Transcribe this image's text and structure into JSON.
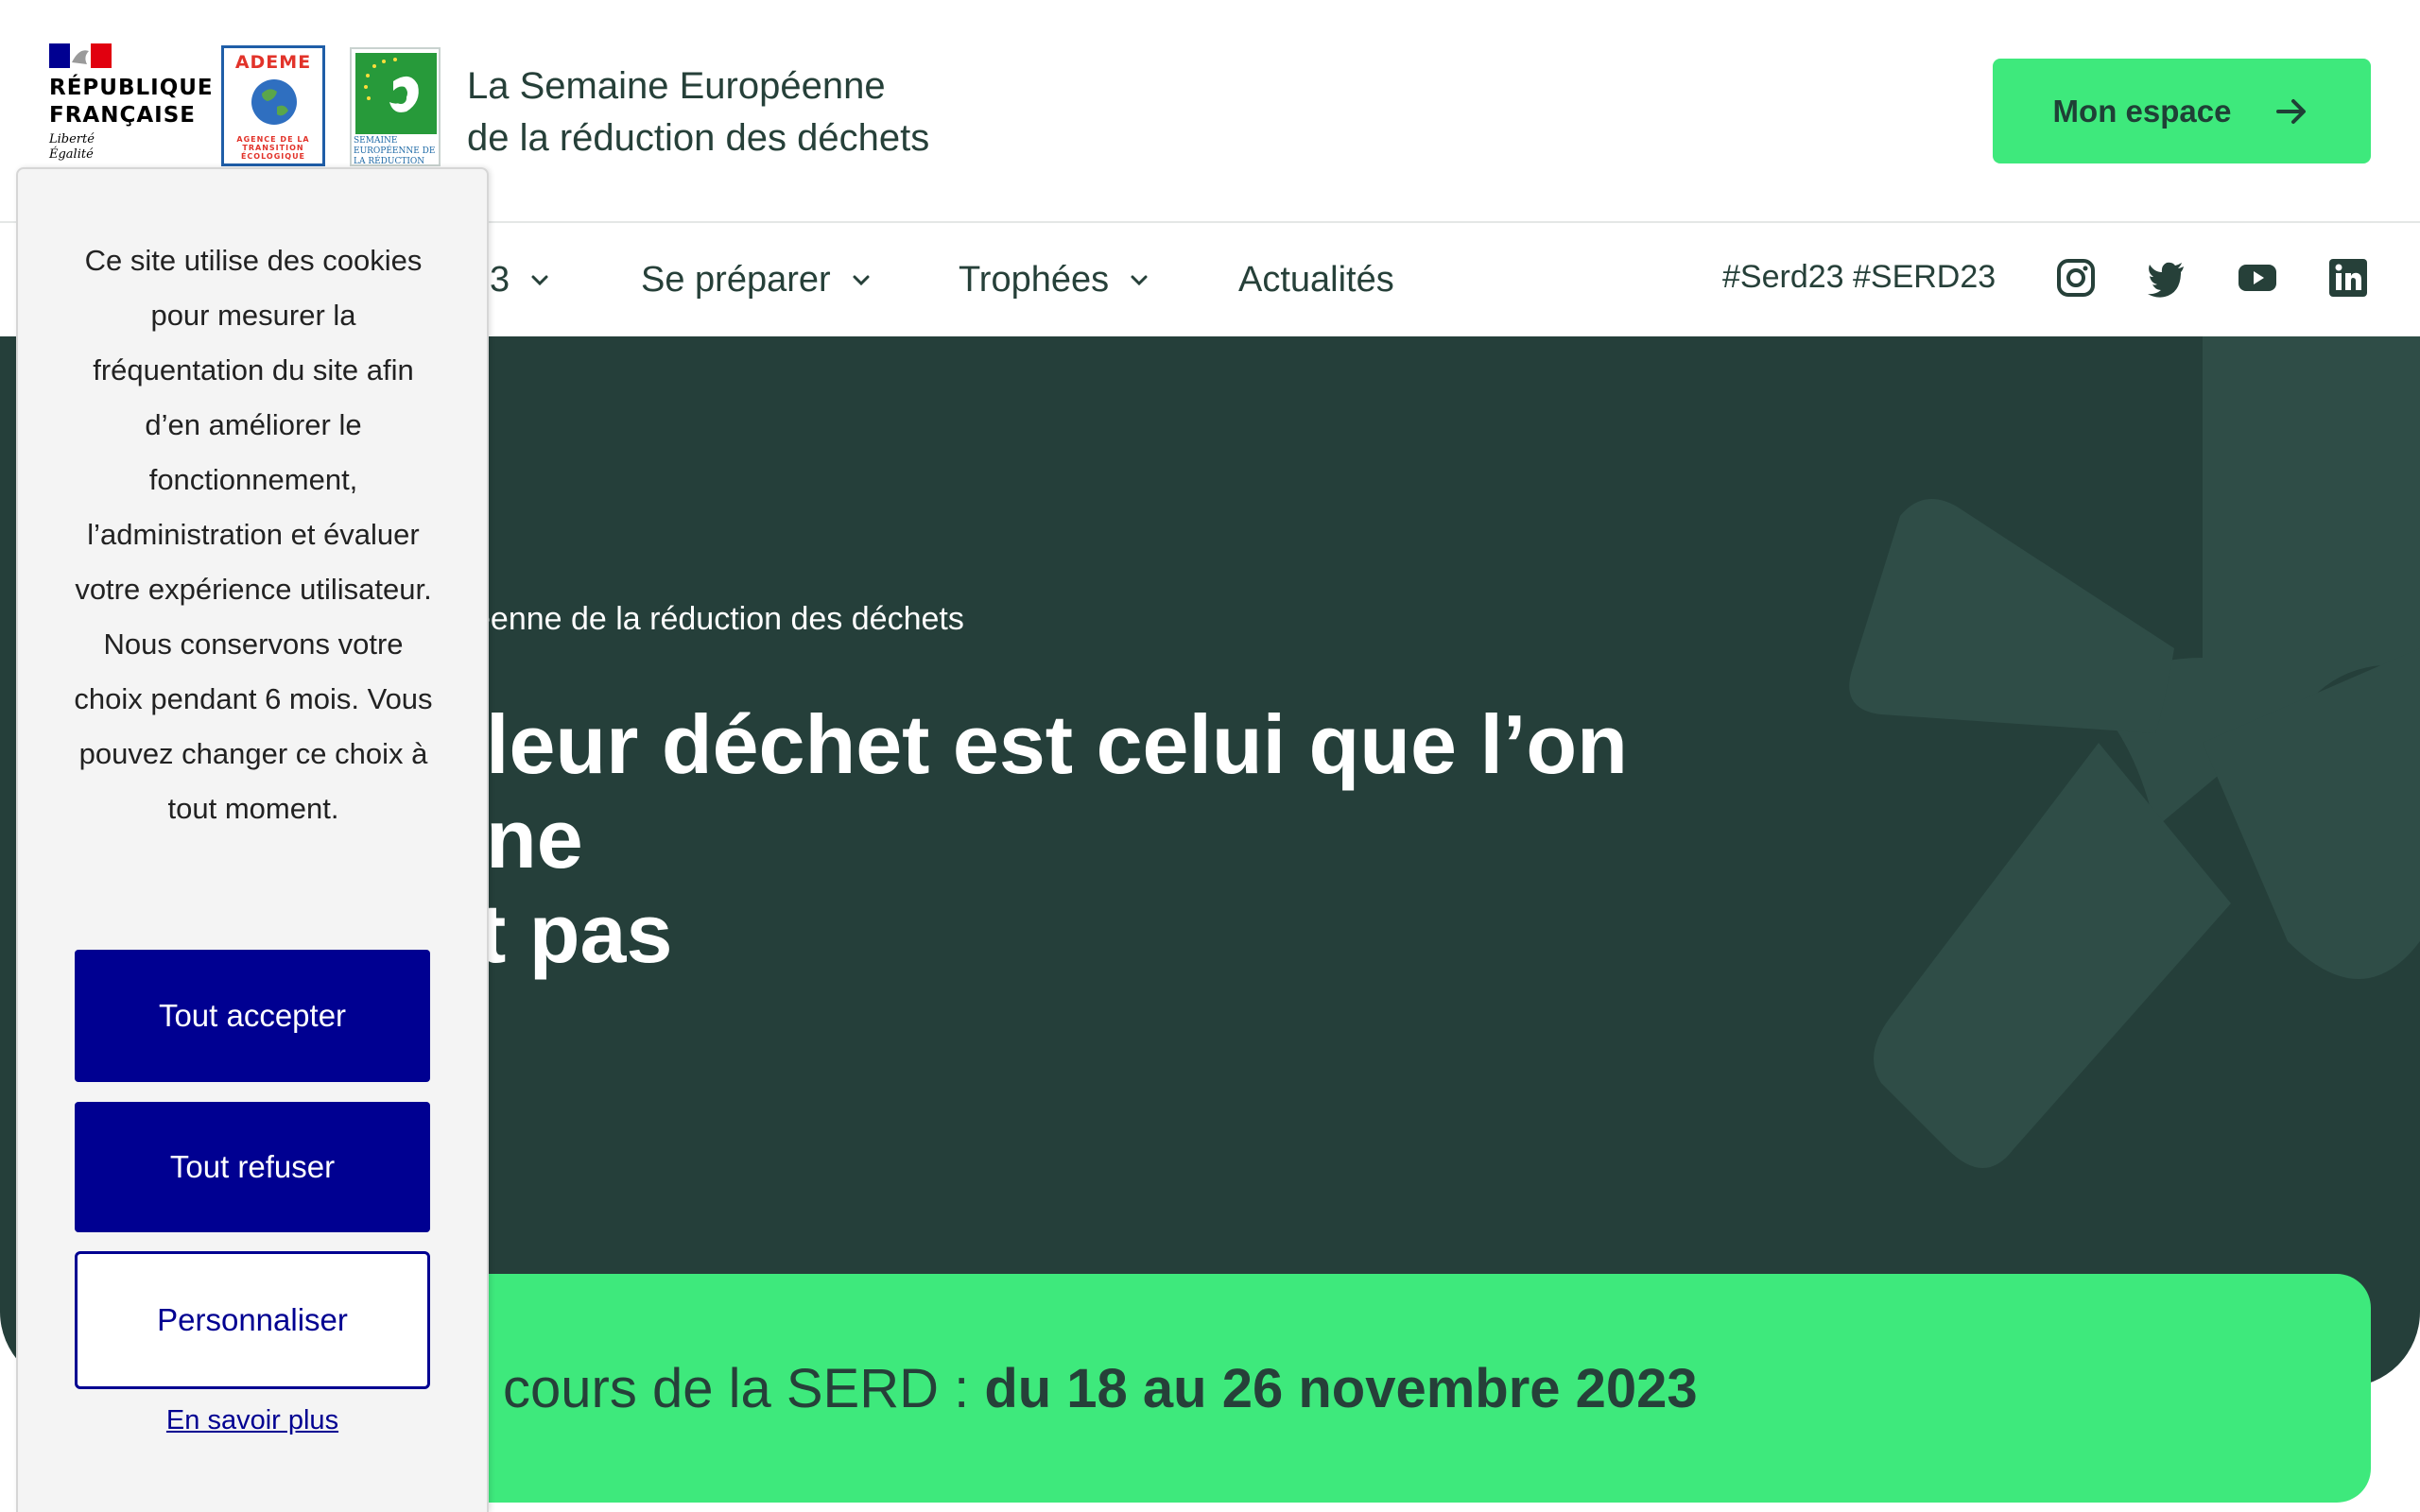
{
  "header": {
    "logos": {
      "rf_line1": "RÉPUBLIQUE",
      "rf_line2": "FRANÇAISE",
      "rf_motto1": "Liberté",
      "rf_motto2": "Égalité",
      "ademe_name": "ADEME",
      "ademe_sub": "AGENCE DE LA TRANSITION ÉCOLOGIQUE",
      "serd_sub": "SEMAINE EUROPÉENNE DE LA RÉDUCTION DES DÉCHETS"
    },
    "site_title_line1": "La Semaine Européenne",
    "site_title_line2": "de la réduction des déchets",
    "account_button": "Mon espace"
  },
  "nav": {
    "items": [
      {
        "label": "3"
      },
      {
        "label": "Se préparer"
      },
      {
        "label": "Trophées"
      },
      {
        "label": "Actualités"
      }
    ],
    "hashtags": "#Serd23 #SERD23",
    "social": [
      "instagram-icon",
      "twitter-icon",
      "youtube-icon",
      "linkedin-icon"
    ]
  },
  "hero": {
    "kicker": "éenne de la réduction des déchets",
    "title_line1": "leur déchet est celui que l’on ne",
    "title_line2": "t pas"
  },
  "banner": {
    "text_prefix": "cours de la SERD : ",
    "text_dates": "du 18 au 26 novembre 2023"
  },
  "cookie": {
    "message": "Ce site utilise des cookies pour mesurer la fréquentation du site afin d’en améliorer le fonctionnement, l’administration et évaluer votre expérience utilisateur. Nous conservons votre choix pendant 6 mois. Vous pouvez changer ce choix à tout moment.",
    "accept_label": "Tout accepter",
    "refuse_label": "Tout refuser",
    "customize_label": "Personnaliser",
    "more_label": "En savoir plus"
  },
  "colors": {
    "accent_green": "#3ee97c",
    "hero_bg": "#253f3a",
    "cookie_blue": "#000091",
    "text_dark": "#264039"
  }
}
